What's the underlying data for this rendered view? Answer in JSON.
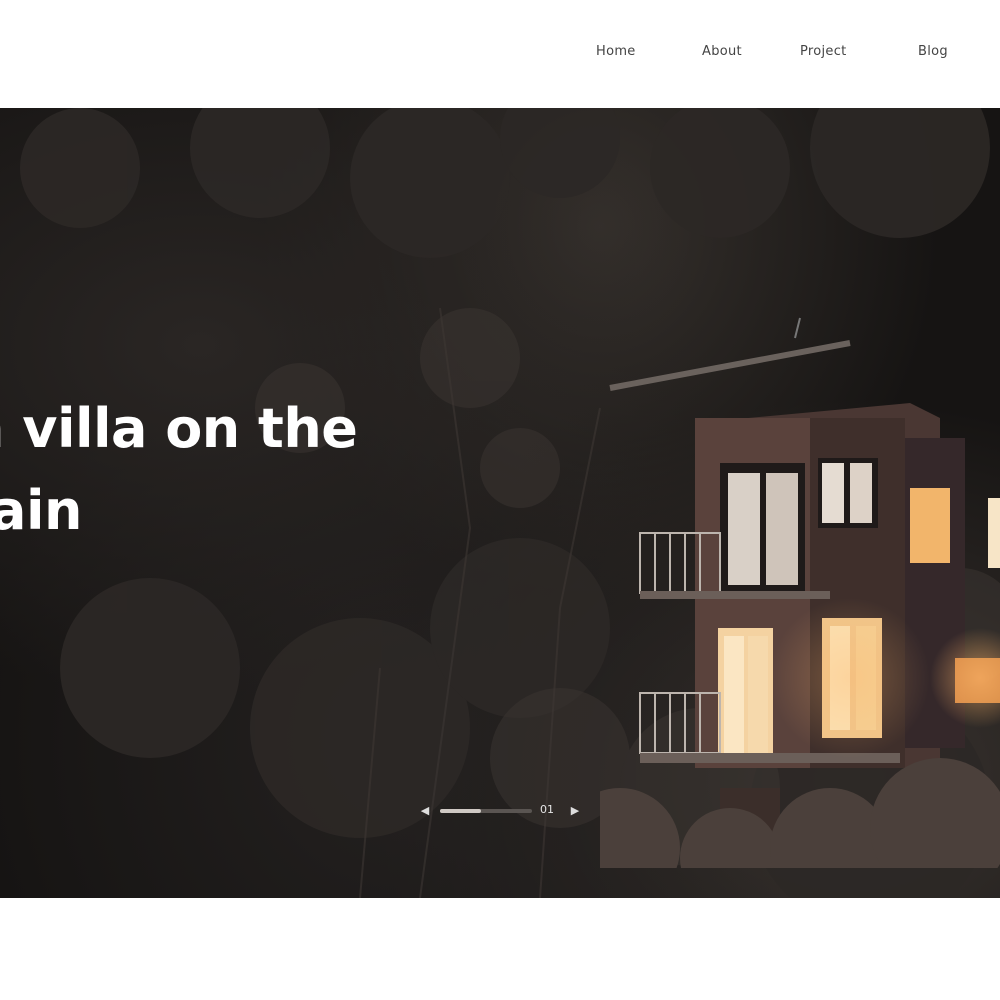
{
  "nav": {
    "items": [
      {
        "label": "Home"
      },
      {
        "label": "About"
      },
      {
        "label": "Project"
      },
      {
        "label": "Blog"
      }
    ]
  },
  "hero": {
    "title_line1": "n villa on the",
    "title_line2": "ain",
    "background_color": "#161413"
  },
  "slider": {
    "prev_icon": "chevron-left-icon",
    "next_icon": "chevron-right-icon",
    "counter": "01",
    "progress": 0.45
  }
}
